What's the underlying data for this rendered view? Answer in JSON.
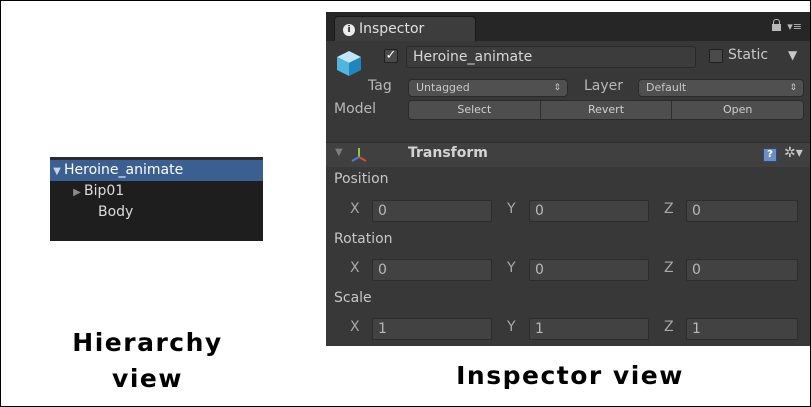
{
  "hierarchy": {
    "items": [
      {
        "label": "Heroine_animate",
        "selected": true,
        "expanded": true
      },
      {
        "label": "Bip01",
        "has_children": true
      },
      {
        "label": "Body",
        "has_children": false
      }
    ]
  },
  "inspector": {
    "tab_label": "Inspector",
    "icons": {
      "tab": "info-icon",
      "lock": "lock-icon",
      "menu": "menu-icon"
    },
    "gameobject": {
      "icon": "cube-icon",
      "active": true,
      "name": "Heroine_animate",
      "static_label": "Static",
      "static": false,
      "tag_label": "Tag",
      "tag_value": "Untagged",
      "layer_label": "Layer",
      "layer_value": "Default",
      "model_label": "Model",
      "model_buttons": [
        "Select",
        "Revert",
        "Open"
      ]
    },
    "transform": {
      "title": "Transform",
      "icons": {
        "component": "transform-axes-icon",
        "help": "help-icon",
        "settings": "gear-icon"
      },
      "position_label": "Position",
      "rotation_label": "Rotation",
      "scale_label": "Scale",
      "position": {
        "x": "0",
        "y": "0",
        "z": "0"
      },
      "rotation": {
        "x": "0",
        "y": "0",
        "z": "0"
      },
      "scale": {
        "x": "1",
        "y": "1",
        "z": "1"
      },
      "axis_labels": {
        "x": "X",
        "y": "Y",
        "z": "Z"
      }
    }
  },
  "captions": {
    "hierarchy": [
      "Hierarchy",
      "view"
    ],
    "inspector": "Inspector view"
  },
  "colors": {
    "selection": "#3b5f93",
    "panel": "#383838",
    "hierarchy_bg": "#1e1e1e"
  }
}
